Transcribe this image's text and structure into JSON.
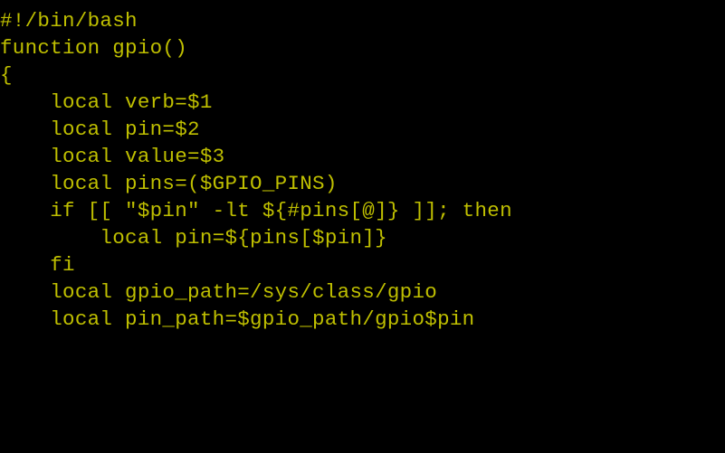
{
  "code": {
    "lines": [
      "#!/bin/bash",
      "",
      "function gpio()",
      "{",
      "    local verb=$1",
      "    local pin=$2",
      "    local value=$3",
      "",
      "    local pins=($GPIO_PINS)",
      "    if [[ \"$pin\" -lt ${#pins[@]} ]]; then",
      "        local pin=${pins[$pin]}",
      "    fi",
      "",
      "    local gpio_path=/sys/class/gpio",
      "    local pin_path=$gpio_path/gpio$pin"
    ]
  }
}
